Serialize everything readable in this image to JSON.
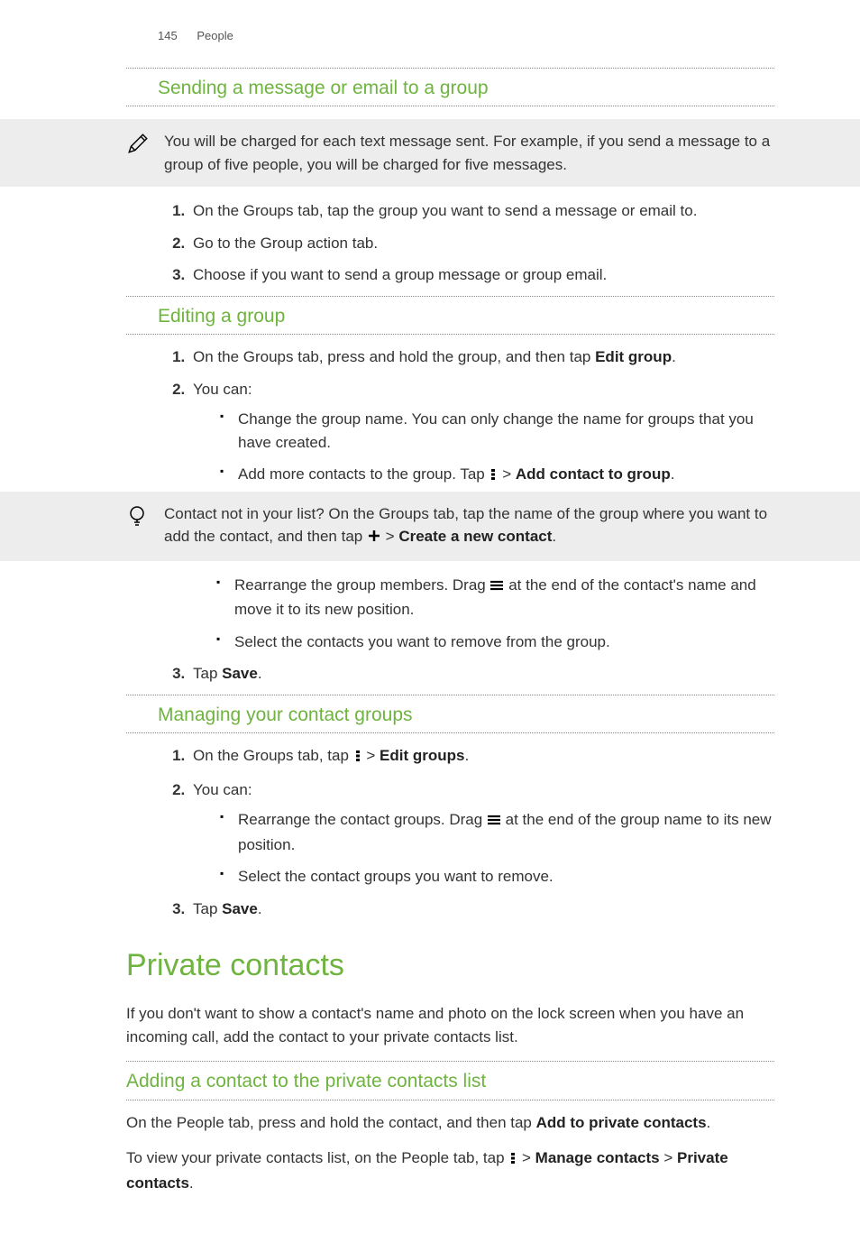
{
  "header": {
    "page_number": "145",
    "section": "People"
  },
  "sec1": {
    "title": "Sending a message or email to a group",
    "note": "You will be charged for each text message sent. For example, if you send a message to a group of five people, you will be charged for five messages.",
    "steps": [
      "On the Groups tab, tap the group you want to send a message or email to.",
      "Go to the Group action tab.",
      "Choose if you want to send a group message or group email."
    ]
  },
  "sec2": {
    "title": "Editing a group",
    "step1_pre": "On the Groups tab, press and hold the group, and then tap ",
    "step1_bold": "Edit group",
    "period": ".",
    "step2": "You can:",
    "bullet1": "Change the group name. You can only change the name for groups that you have created.",
    "bullet2_pre": "Add more contacts to the group. Tap ",
    "bullet2_sep": " > ",
    "bullet2_bold": "Add contact to group",
    "tip_pre": "Contact not in your list? On the Groups tab, tap the name of the group where you want to add the contact, and then tap ",
    "tip_bold": "Create a new contact",
    "bullet3_pre": "Rearrange the group members. Drag ",
    "bullet3_post": " at the end of the contact's name and move it to its new position.",
    "bullet4": "Select the contacts you want to remove from the group.",
    "step3_pre": "Tap ",
    "step3_bold": "Save"
  },
  "sec3": {
    "title": "Managing your contact groups",
    "step1_pre": "On the Groups tab, tap ",
    "step1_sep": " > ",
    "step1_bold": "Edit groups",
    "step2": "You can:",
    "bullet1_pre": "Rearrange the contact groups. Drag ",
    "bullet1_post": " at the end of the group name to its new position.",
    "bullet2": "Select the contact groups you want to remove.",
    "step3_pre": "Tap ",
    "step3_bold": "Save"
  },
  "sec4": {
    "title": "Private contacts",
    "intro": "If you don't want to show a contact's name and photo on the lock screen when you have an incoming call, add the contact to your private contacts list.",
    "sub_title": "Adding a contact to the private contacts list",
    "p1_pre": "On the People tab, press and hold the contact, and then tap ",
    "p1_bold": "Add to private contacts",
    "p2_pre": "To view your private contacts list, on the People tab, tap ",
    "p2_sep": " > ",
    "p2_bold1": "Manage contacts",
    "p2_mid": " > ",
    "p2_bold2": "Private contacts"
  }
}
